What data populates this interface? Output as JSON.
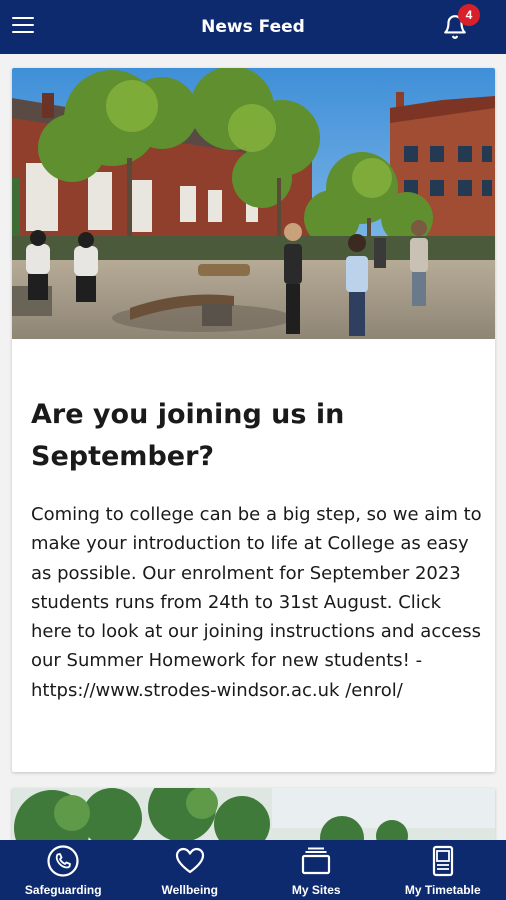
{
  "header": {
    "title": "News Feed",
    "notification_count": "4"
  },
  "feed": {
    "posts": [
      {
        "title": "Are you joining us in September?",
        "body": "Coming to college can be a big step, so we aim to make your introduction to life at College as easy as possible. Our enrolment for September 2023 students runs from 24th to 31st August. Click here to look at our joining instructions and access our Summer Homework for new students! - https://www.strodes-windsor.ac.uk /enrol/"
      }
    ]
  },
  "bottom_nav": {
    "items": [
      {
        "label": "Safeguarding",
        "icon": "phone-icon"
      },
      {
        "label": "Wellbeing",
        "icon": "heart-icon"
      },
      {
        "label": "My Sites",
        "icon": "sites-icon"
      },
      {
        "label": "My Timetable",
        "icon": "timetable-icon"
      }
    ]
  },
  "colors": {
    "brand": "#0e2a6e",
    "badge": "#d8202a",
    "background": "#f2f2f2"
  }
}
